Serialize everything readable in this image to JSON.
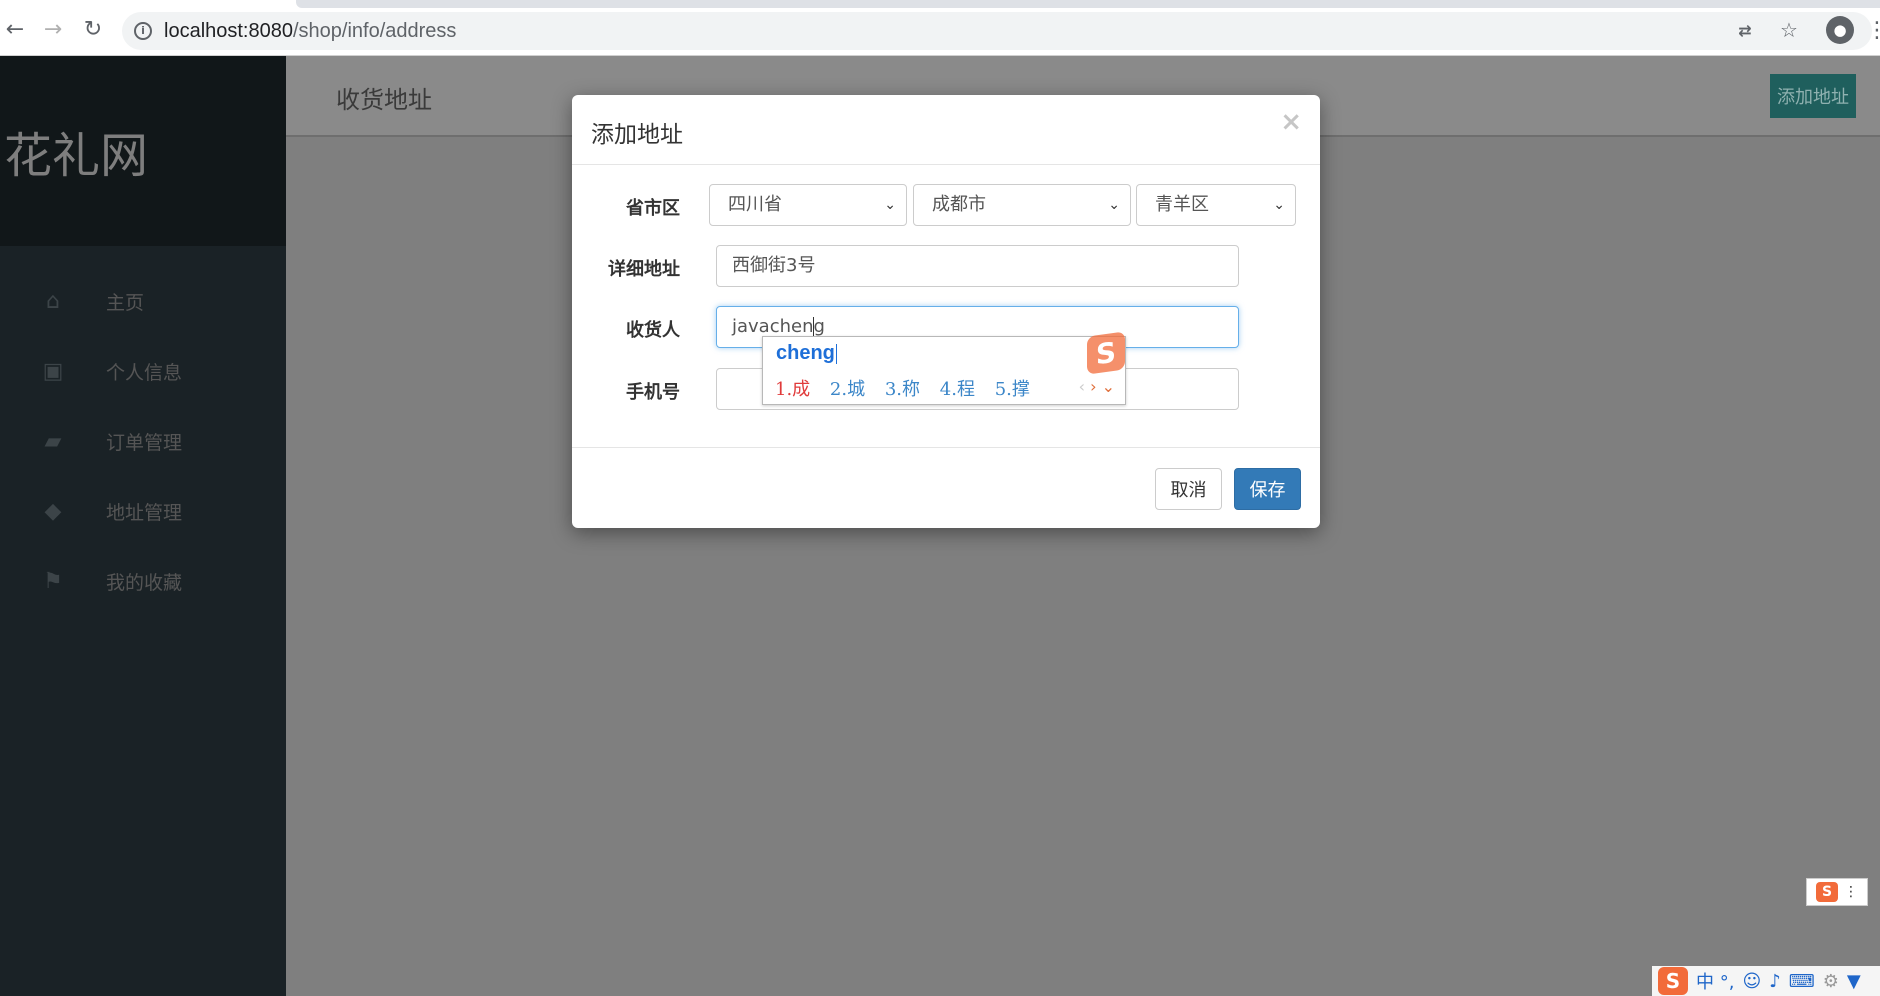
{
  "browser": {
    "url_host": "localhost:8080",
    "url_path": "/shop/info/address"
  },
  "sidebar": {
    "brand": "花礼网",
    "items": [
      {
        "label": "主页",
        "icon": "home-icon"
      },
      {
        "label": "个人信息",
        "icon": "inbox-icon"
      },
      {
        "label": "订单管理",
        "icon": "comments-icon"
      },
      {
        "label": "地址管理",
        "icon": "tag-icon"
      },
      {
        "label": "我的收藏",
        "icon": "flag-icon"
      }
    ]
  },
  "header": {
    "title": "收货地址",
    "add_button": "添加地址"
  },
  "modal": {
    "title": "添加地址",
    "close": "×",
    "region_label": "省市区",
    "province": "四川省",
    "city": "成都市",
    "district": "青羊区",
    "detail_label": "详细地址",
    "detail_value": "西御街3号",
    "receiver_label": "收货人",
    "receiver_value": "javacheng",
    "phone_label": "手机号",
    "phone_value": "",
    "cancel": "取消",
    "save": "保存"
  },
  "ime": {
    "composition": "cheng",
    "candidates": [
      "1.成",
      "2.城",
      "3.称",
      "4.程",
      "5.撑"
    ],
    "status_chars": "中 °,"
  },
  "colors": {
    "sidebar_bg": "#1a2226",
    "overlay": "#7f7f7f",
    "primary": "#337ab7",
    "add_button": "#1f5f5d"
  }
}
